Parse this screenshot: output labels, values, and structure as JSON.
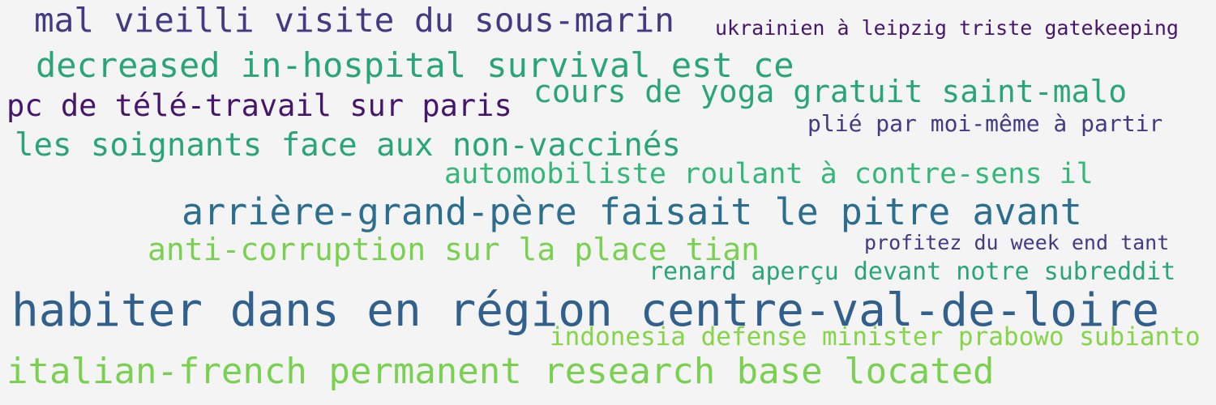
{
  "palette": {
    "background": "#f4f4f4",
    "indigo": "#443983",
    "purple": "#46166b",
    "teal_green": "#2aa57a",
    "mid_green": "#35b779",
    "blue_teal": "#2c6e8e",
    "light_green": "#7ad151",
    "steel_blue": "#31608d",
    "lime": "#86d549"
  },
  "words": [
    {
      "text": "mal vieilli visite du sous-marin",
      "color": "#443983"
    },
    {
      "text": "ukrainien à leipzig triste gatekeeping",
      "color": "#46166b"
    },
    {
      "text": "decreased in-hospital survival est ce",
      "color": "#2aa57a"
    },
    {
      "text": "cours de yoga gratuit saint-malo",
      "color": "#2aa57a"
    },
    {
      "text": "pc de télé-travail sur paris",
      "color": "#46166b"
    },
    {
      "text": "plié par moi-même à partir",
      "color": "#433a83"
    },
    {
      "text": "les soignants face aux non-vaccinés",
      "color": "#2aa57a"
    },
    {
      "text": "automobiliste roulant à contre-sens il",
      "color": "#35b779"
    },
    {
      "text": "arrière-grand-père faisait le pitre avant",
      "color": "#2c6e8e"
    },
    {
      "text": "anti-corruption sur la place tian",
      "color": "#7ad151"
    },
    {
      "text": "profitez du week end tant",
      "color": "#433a83"
    },
    {
      "text": "renard aperçu devant notre subreddit",
      "color": "#2aa57a"
    },
    {
      "text": "habiter dans en région centre-val-de-loire",
      "color": "#31608d"
    },
    {
      "text": "indonesia defense minister prabowo subianto",
      "color": "#86d549"
    },
    {
      "text": "italian-french permanent research base located",
      "color": "#7ad151"
    }
  ]
}
